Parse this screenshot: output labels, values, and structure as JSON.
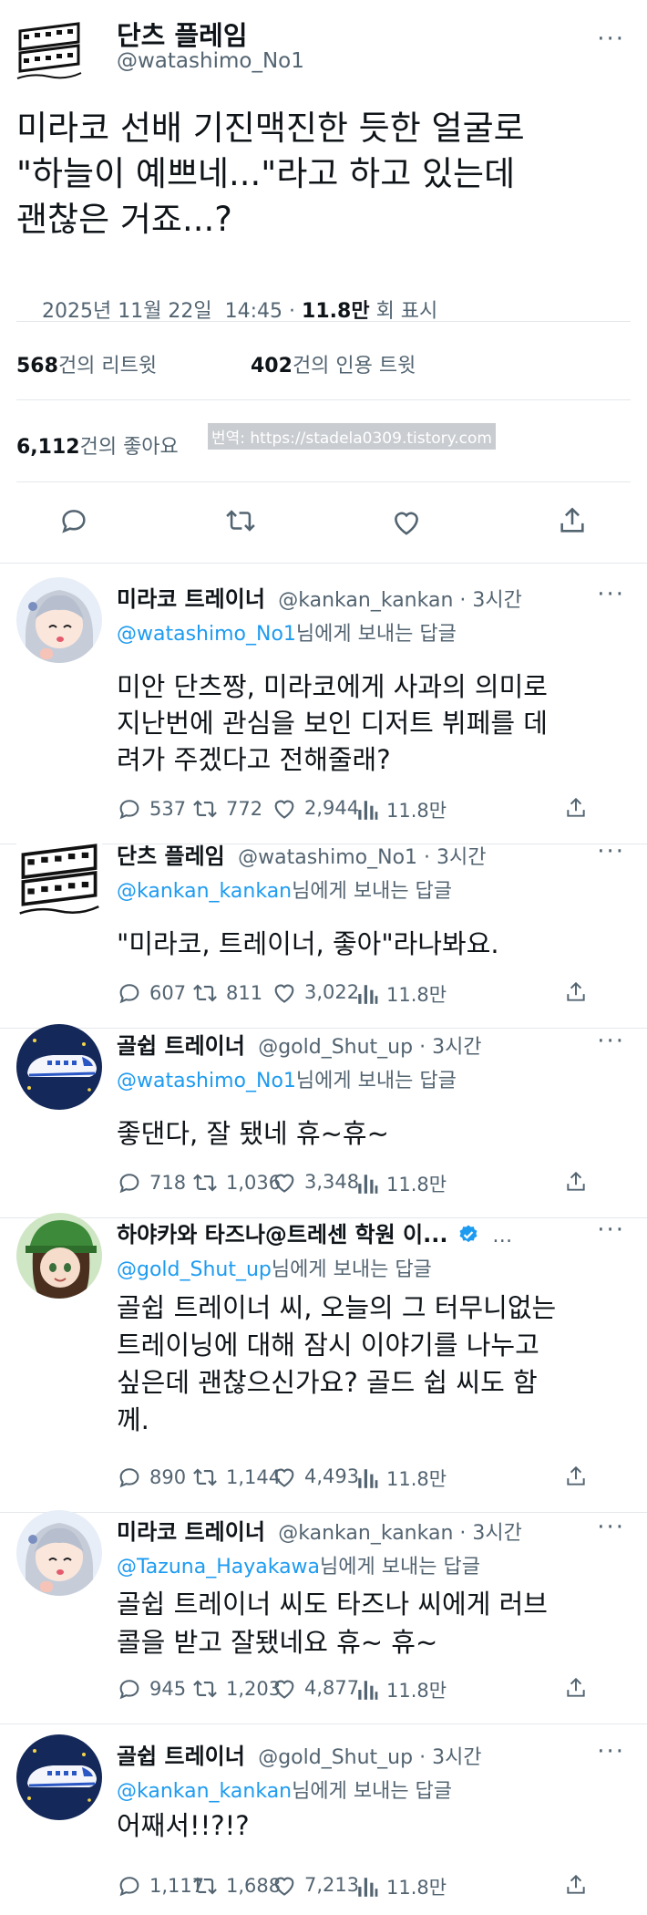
{
  "main_tweet": {
    "display_name": "단츠 플레임",
    "handle": "@watashimo_No1",
    "text_lines": [
      "미라코 선배 기진맥진한 듯한 얼굴로",
      "\"하늘이 예쁘네...\"라고 하고 있는데",
      "괜찮은 거죠...?"
    ],
    "date": "2025년 11월 22일  14:45 · ",
    "views": "11.8만",
    "views_suffix": " 회 표시",
    "retweets_count": "568",
    "retweets_label": "건의 리트윗",
    "quotes_count": "402",
    "quotes_label": "건의 인용 트윗",
    "likes_count": "6,112",
    "likes_label": "건의 좋아요",
    "watermark": "번역: https://stadela0309.tistory.com",
    "more": "···"
  },
  "replies": [
    {
      "avatar": "silver-hair-girl-avatar",
      "display_name": "미라코 트레이너",
      "handle_time": "@kankan_kankan · 3시간",
      "reply_to_handle": "@watashimo_No1",
      "reply_to_suffix": "님에게 보내는 답글",
      "lines": [
        "미안 단츠짱, 미라코에게 사과의 의미로",
        "지난번에 관심을 보인 디저트 뷔페를 데",
        "려가 주겠다고 전해줄래?"
      ],
      "replies": "537",
      "retweets": "772",
      "likes": "2,944",
      "views": "11.8만"
    },
    {
      "avatar": "film-strip-avatar",
      "display_name": "단츠 플레임",
      "handle_time": "@watashimo_No1 · 3시간",
      "reply_to_handle": "@kankan_kankan",
      "reply_to_suffix": "님에게 보내는 답글",
      "lines": [
        "\"미라코, 트레이너, 좋아\"라나봐요."
      ],
      "replies": "607",
      "retweets": "811",
      "likes": "3,022",
      "views": "11.8만"
    },
    {
      "avatar": "shinkansen-avatar",
      "display_name": "골쉽 트레이너",
      "handle_time": "@gold_Shut_up · 3시간",
      "reply_to_handle": "@watashimo_No1",
      "reply_to_suffix": "님에게 보내는 답글",
      "lines": [
        "좋댄다, 잘 됐네 휴~휴~"
      ],
      "replies": "718",
      "retweets": "1,036",
      "likes": "3,348",
      "views": "11.8만"
    },
    {
      "avatar": "green-hat-girl-avatar",
      "display_name": "하야카와 타즈나@트레센 학원 이...",
      "handle_time": "…",
      "reply_to_handle": "@gold_Shut_up",
      "reply_to_suffix": "님에게 보내는 답글",
      "lines": [
        "골쉽 트레이너 씨, 오늘의 그 터무니없는",
        "트레이닝에 대해 잠시 이야기를 나누고",
        "싶은데 괜찮으신가요? 골드 쉽 씨도 함",
        "께."
      ],
      "replies": "890",
      "retweets": "1,144",
      "likes": "4,493",
      "views": "11.8만"
    },
    {
      "avatar": "silver-hair-girl-avatar",
      "display_name": "미라코 트레이너",
      "handle_time": "@kankan_kankan · 3시간",
      "reply_to_handle": "@Tazuna_Hayakawa",
      "reply_to_suffix": "님에게 보내는 답글",
      "lines": [
        "골쉽 트레이너 씨도 타즈나 씨에게 러브",
        "콜을 받고 잘됐네요 휴~ 휴~"
      ],
      "replies": "945",
      "retweets": "1,203",
      "likes": "4,877",
      "views": "11.8만"
    },
    {
      "avatar": "shinkansen-avatar",
      "display_name": "골쉽 트레이너",
      "handle_time": "@gold_Shut_up · 3시간",
      "reply_to_handle": "@kankan_kankan",
      "reply_to_suffix": "님에게 보내는 답글",
      "lines": [
        "어째서!!?!?"
      ],
      "replies": "1,117",
      "retweets": "1,688",
      "likes": "7,213",
      "views": "11.8만"
    }
  ],
  "colors": {
    "link": "#1d9bf0",
    "muted": "#536471",
    "verified": "#1d9bf0",
    "text": "#0f1419"
  }
}
